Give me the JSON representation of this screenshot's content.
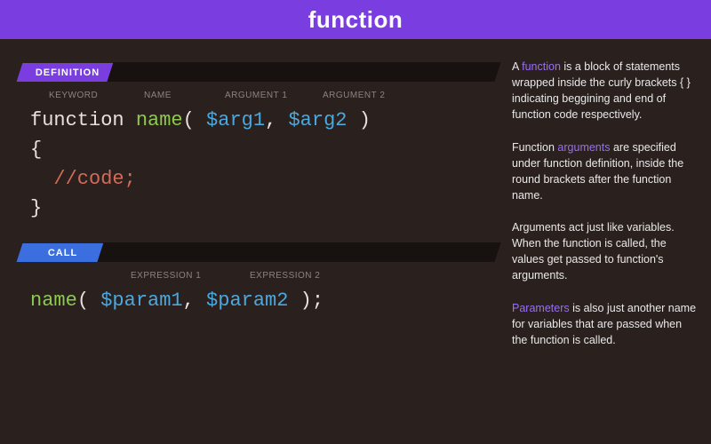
{
  "header": {
    "title": "function"
  },
  "definition": {
    "tag": "DEFINITION",
    "labels": {
      "keyword": "KEYWORD",
      "name": "NAME",
      "arg1": "ARGUMENT 1",
      "arg2": "ARGUMENT 2"
    },
    "code": {
      "keyword": "function",
      "name": "name",
      "open": "(",
      "arg1": "$arg1",
      "comma": ",",
      "arg2": "$arg2",
      "close": ")",
      "braceOpen": "{",
      "comment": "//code;",
      "braceClose": "}"
    }
  },
  "call": {
    "tag": "CALL",
    "labels": {
      "expr1": "EXPRESSION 1",
      "expr2": "EXPRESSION 2"
    },
    "code": {
      "name": "name",
      "open": "(",
      "param1": "$param1",
      "comma": ",",
      "param2": "$param2",
      "close": ");"
    }
  },
  "sidebar": {
    "p1a": "A ",
    "p1_hl": "function",
    "p1b": " is a block of statements wrapped inside the curly brackets {  } indicating beggining and end of function code respectively.",
    "p2a": "Function ",
    "p2_hl": "arguments",
    "p2b": " are specified under function definition, inside the round brackets after the function name.",
    "p3": "Arguments act just like variables. When the function is called, the values get passed to function's arguments.",
    "p4_hl": "Parameters",
    "p4b": " is also just another name for variables that are passed when the function is called."
  }
}
